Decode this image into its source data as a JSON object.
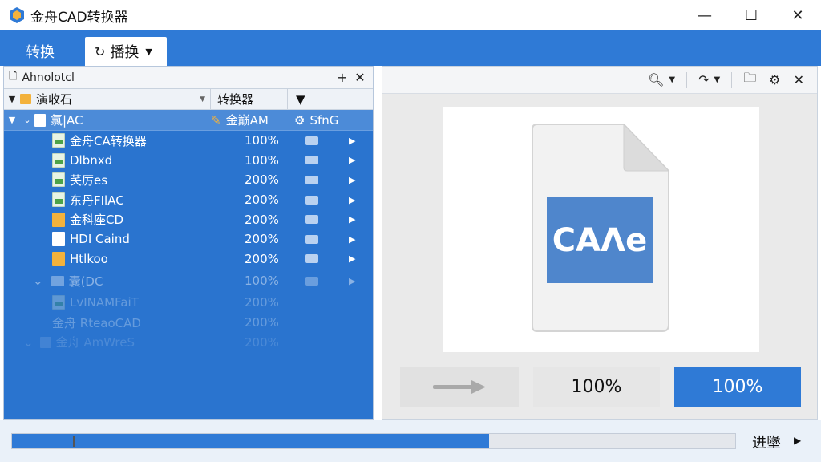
{
  "app": {
    "title": "金舟CAD转换器"
  },
  "window": {
    "minimize": "—",
    "maximize": "☐",
    "close": "✕"
  },
  "ribbon": {
    "tabs": [
      {
        "label": "转换"
      },
      {
        "label": "播换",
        "icon": "refresh-icon"
      }
    ]
  },
  "left_panel": {
    "title": "Ahnolotcl",
    "add_btn": "+",
    "close_btn": "✕",
    "columns": {
      "name": "演收石",
      "converter": "转换器"
    },
    "group": {
      "name": "氯|AC",
      "converter": "金巅AM",
      "format": "SfnG"
    },
    "rows": [
      {
        "name": "金舟CA转换器",
        "percent": "100%",
        "icon": "image-file-icon"
      },
      {
        "name": "Dlbnxd",
        "percent": "100%",
        "icon": "image-file-icon"
      },
      {
        "name": "芺厉es",
        "percent": "200%",
        "icon": "image-file-icon"
      },
      {
        "name": "东丹FIlAC",
        "percent": "200%",
        "icon": "image-file-icon"
      },
      {
        "name": "金科座CD",
        "percent": "200%",
        "icon": "yellow-file-icon"
      },
      {
        "name": "HDI Caind",
        "percent": "200%",
        "icon": "blank-file-icon"
      },
      {
        "name": "Htlkoo",
        "percent": "200%",
        "icon": "yellow-file-icon"
      }
    ],
    "sub_group": {
      "name": "囊(DC",
      "percent": "100%"
    },
    "faded_rows": [
      {
        "name": "LvINAMFaiT",
        "percent": "200%"
      },
      {
        "name": "金舟 RteaoCAD",
        "percent": "200%"
      },
      {
        "name": "金舟 AmWreS",
        "percent": "200%"
      }
    ]
  },
  "preview": {
    "doc_label": "CAɅe",
    "zoom_a": "100%",
    "zoom_b": "100%"
  },
  "bottom": {
    "progress_label": "进墬",
    "progress_value": 0.66
  },
  "colors": {
    "accent": "#2f7ad6",
    "panel": "#2a74cf",
    "folder": "#f3b23c"
  }
}
